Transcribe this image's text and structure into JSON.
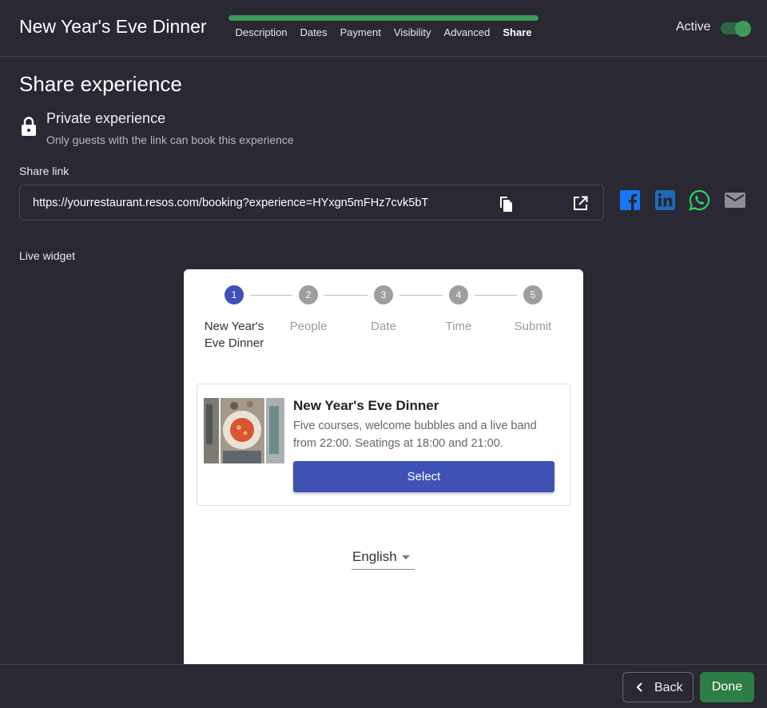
{
  "header": {
    "title": "New Year's Eve Dinner",
    "progress_percent": 100,
    "steps": [
      "Description",
      "Dates",
      "Payment",
      "Visibility",
      "Advanced",
      "Share"
    ],
    "current_step": "Share",
    "active_label": "Active",
    "active_on": true
  },
  "main": {
    "section_title": "Share experience",
    "private": {
      "title": "Private experience",
      "subtitle": "Only guests with the link can book this experience"
    },
    "share_link_label": "Share link",
    "share_link_value": "https://yourrestaurant.resos.com/booking?experience=HYxgn5mFHz7cvk5bT",
    "social": [
      "facebook-icon",
      "linkedin-icon",
      "whatsapp-icon",
      "email-icon"
    ],
    "live_widget_label": "Live widget"
  },
  "widget": {
    "steps": [
      {
        "num": "1",
        "label": "New Year's Eve Dinner"
      },
      {
        "num": "2",
        "label": "People"
      },
      {
        "num": "3",
        "label": "Date"
      },
      {
        "num": "4",
        "label": "Time"
      },
      {
        "num": "5",
        "label": "Submit"
      }
    ],
    "card": {
      "title": "New Year's Eve Dinner",
      "description": "Five courses, welcome bubbles and a live band from 22:00. Seatings at 18:00 and 21:00.",
      "button": "Select"
    },
    "language": "English"
  },
  "footer": {
    "back_label": "Back",
    "done_label": "Done"
  },
  "colors": {
    "background": "#2a2833",
    "accent_green": "#3f9a5b",
    "widget_primary": "#3f51b5"
  }
}
